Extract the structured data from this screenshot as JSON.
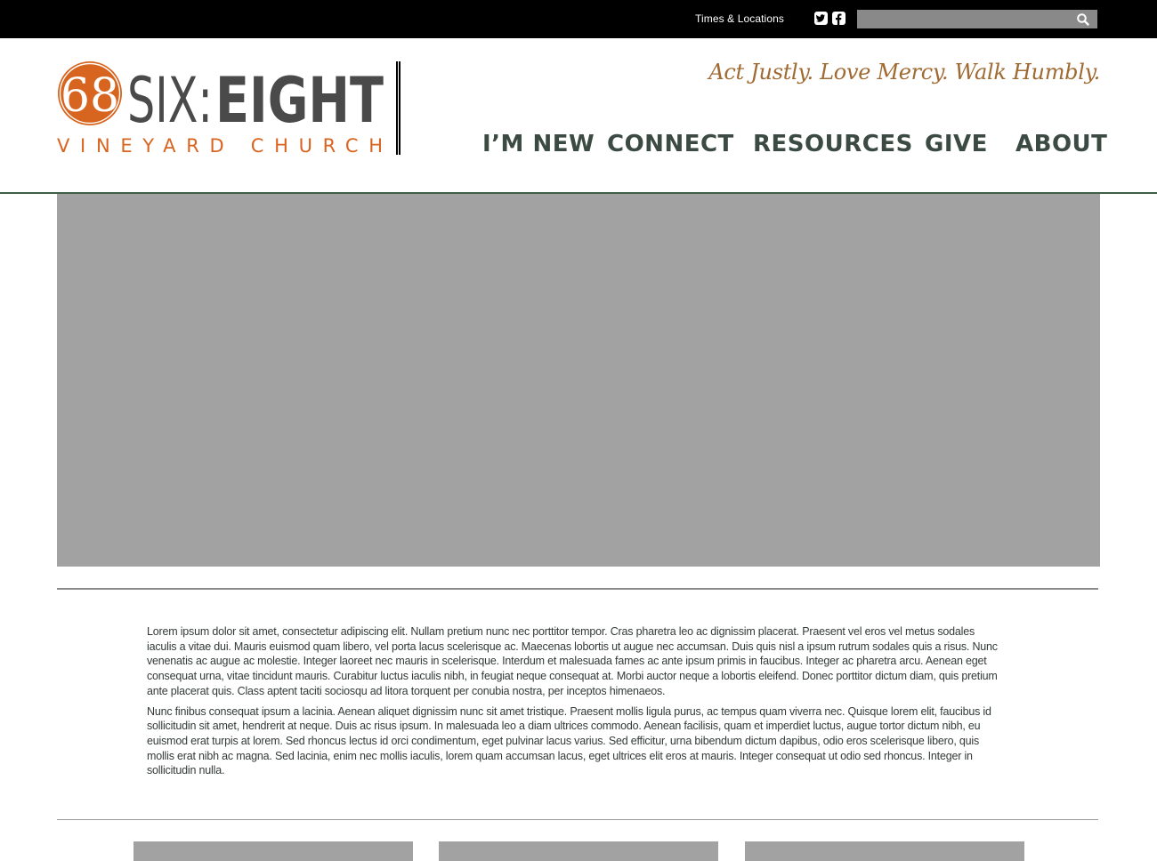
{
  "topbar": {
    "times_link": "Times & Locations",
    "social": [
      "twitter-icon",
      "facebook-icon"
    ],
    "search": {
      "placeholder": "",
      "value": ""
    }
  },
  "header": {
    "logo": {
      "number_glyph": "68",
      "wordmark_left": "SIX:",
      "wordmark_right": "EIGHT",
      "subline": "VINEYARD CHURCH"
    },
    "tagline": "Act Justly. Love Mercy. Walk Humbly.",
    "nav": [
      "I’M NEW",
      "CONNECT",
      "RESOURCES",
      "GIVE",
      "ABOUT"
    ]
  },
  "main": {
    "paragraphs": [
      "Lorem ipsum dolor sit amet, consectetur adipiscing elit. Nullam pretium nunc nec porttitor tempor. Cras pharetra leo ac dignissim placerat. Praesent vel eros vel metus sodales iaculis a vitae dui. Mauris euismod quam libero, vel porta lacus scelerisque ac. Maecenas lobortis ut augue nec accumsan. Duis quis nisl a ipsum rutrum sodales quis a risus. Nunc venenatis ac augue ac molestie. Integer laoreet nec mauris in scelerisque. Interdum et malesuada fames ac ante ipsum primis in faucibus. Integer ac pharetra arcu. Aenean eget consequat urna, vitae tincidunt mauris. Curabitur luctus iaculis nibh, in feugiat neque consequat at. Morbi auctor neque a lobortis eleifend. Donec porttitor dictum diam, quis pretium ante placerat quis. Class aptent taciti sociosqu ad litora torquent per conubia nostra, per inceptos himenaeos.",
      "Nunc finibus consequat ipsum a lacinia. Aenean aliquet dignissim nunc sit amet tristique. Praesent mollis ligula purus, ac tempus quam viverra nec. Quisque lorem elit, faucibus id sollicitudin sit amet, hendrerit at neque. Duis ac risus ipsum. In malesuada leo a diam ultrices commodo. Aenean facilisis, quam et imperdiet luctus, augue tortor dictum nibh, eu euismod erat turpis at lorem. Sed rhoncus lectus id orci condimentum, eget pulvinar lacus varius. Sed efficitur, urna bibendum dictum dapibus, odio eros scelerisque libero, quis mollis erat nibh ac magna. Sed lacinia, enim nec mollis iaculis, lorem quam accumsan lacus, eget ultrices elit eros at mauris. Integer consequat ut odio sed rhoncus. Integer in sollicitudin nulla."
    ]
  },
  "colors": {
    "topbar_bg": "#000000",
    "brand_orange": "#d8651f",
    "wordmark_gray": "#4a4a4a",
    "tagline_gold": "#a06a33",
    "nav_text": "#3b4a42",
    "header_rule": "#3f5e46",
    "placeholder_gray": "#a2a2a2"
  }
}
